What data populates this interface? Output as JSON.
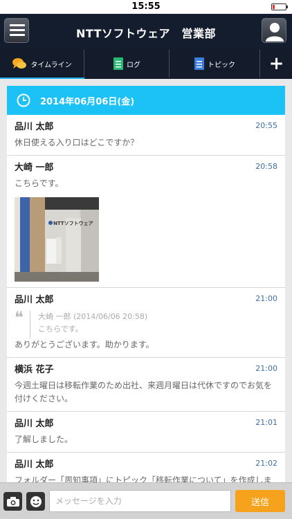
{
  "status_bar": {
    "time": "15:55"
  },
  "header": {
    "title": "NTTソフトウェア　営業部",
    "menu_icon": "menu-icon",
    "profile_icon": "user-icon"
  },
  "tabs": [
    {
      "label": "タイムライン",
      "icon": "speech-bubble-icon",
      "active": true
    },
    {
      "label": "ログ",
      "icon": "document-icon",
      "active": false
    },
    {
      "label": "トピック",
      "icon": "topic-document-icon",
      "active": false
    },
    {
      "label": "+",
      "icon": "plus-icon",
      "active": false
    }
  ],
  "feed": {
    "date": "2014年06月06日(金)",
    "messages": [
      {
        "name": "品川 太郎",
        "time": "20:55",
        "body": "休日使える入り口はどこですか？"
      },
      {
        "name": "大崎 一郎",
        "time": "20:58",
        "body": "こちらです。",
        "photo_text": "NTTソフトウェア"
      },
      {
        "name": "品川 太郎",
        "time": "21:00",
        "quote_header": "大崎 一郎 (2014/06/06 20:58)",
        "quote_body": "こちらです。",
        "body": "ありがとうございます。助かります。"
      },
      {
        "name": "横浜 花子",
        "time": "21:00",
        "body": "今週土曜日は移転作業のため出社、来週月曜日は代休ですのでお気を付けください。"
      },
      {
        "name": "品川 太郎",
        "time": "21:01",
        "body": "了解しました。"
      },
      {
        "name": "品川 太郎",
        "time": "21:02",
        "body": "フォルダー「周知事項」にトピック「移転作業について」を作成しました。"
      }
    ]
  },
  "input_bar": {
    "placeholder": "メッセージを入力",
    "send_label": "送信",
    "camera_icon": "camera-icon",
    "emoji_icon": "smiley-icon"
  },
  "colors": {
    "nav_bg": "#131d2e",
    "accent": "#1cc2f5",
    "send": "#f7a21c",
    "time_text": "#3e6ea5"
  }
}
